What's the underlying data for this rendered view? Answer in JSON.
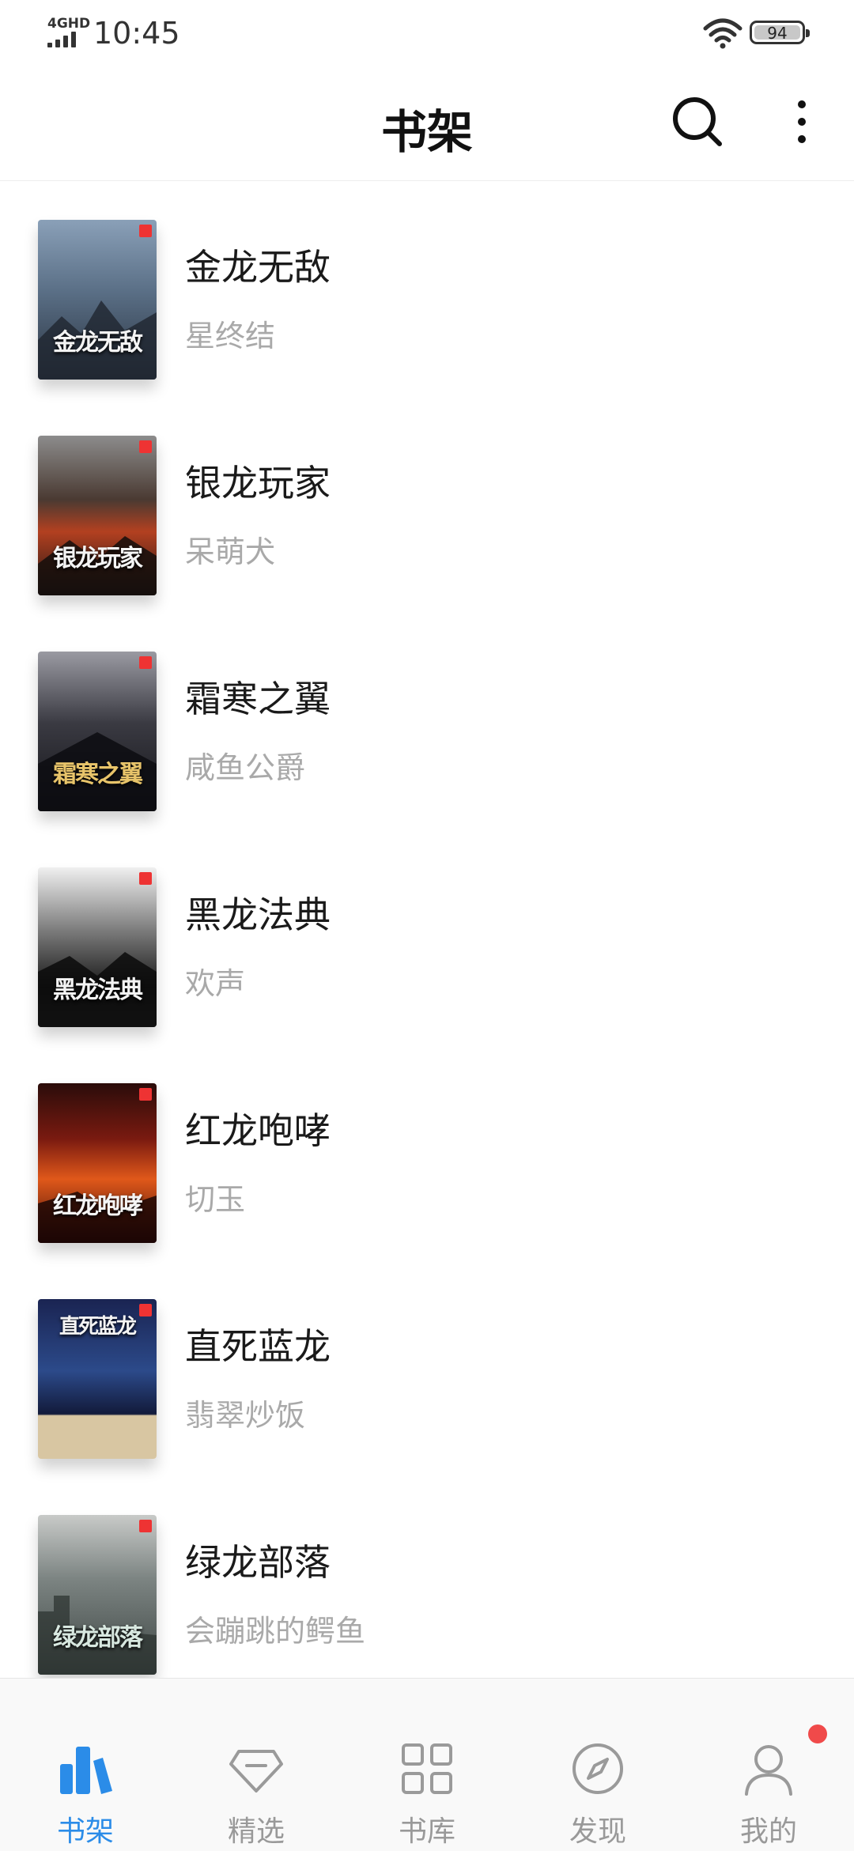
{
  "status_bar": {
    "network": "4GHD",
    "time": "10:45",
    "battery": "94"
  },
  "header": {
    "title": "书架"
  },
  "books": [
    {
      "title": "金龙无敌",
      "author": "星终结",
      "cover_title": "金龙无敌",
      "cover_color": "#5a6f86"
    },
    {
      "title": "银龙玩家",
      "author": "呆萌犬",
      "cover_title": "银龙玩家",
      "cover_color": "#3c2e2a"
    },
    {
      "title": "霜寒之翼",
      "author": "咸鱼公爵",
      "cover_title": "霜寒之翼",
      "cover_color": "#2a2a30"
    },
    {
      "title": "黑龙法典",
      "author": "欢声",
      "cover_title": "黑龙法典",
      "cover_color": "#6e6e6e"
    },
    {
      "title": "红龙咆哮",
      "author": "切玉",
      "cover_title": "红龙咆哮",
      "cover_color": "#6a1a14"
    },
    {
      "title": "直死蓝龙",
      "author": "翡翠炒饭",
      "cover_title": "直死蓝龙",
      "cover_color": "#1f2d5e"
    },
    {
      "title": "绿龙部落",
      "author": "会蹦跳的鳄鱼",
      "cover_title": "绿龙部落",
      "cover_color": "#5d6664"
    }
  ],
  "nav": {
    "tabs": [
      {
        "label": "书架",
        "icon": "bookshelf-icon",
        "active": true
      },
      {
        "label": "精选",
        "icon": "diamond-icon",
        "active": false
      },
      {
        "label": "书库",
        "icon": "grid-icon",
        "active": false
      },
      {
        "label": "发现",
        "icon": "compass-icon",
        "active": false
      },
      {
        "label": "我的",
        "icon": "user-icon",
        "active": false
      }
    ],
    "accent_color": "#2b8ce8",
    "inactive_color": "#999999",
    "notification_dot_color": "#f04a4a"
  }
}
